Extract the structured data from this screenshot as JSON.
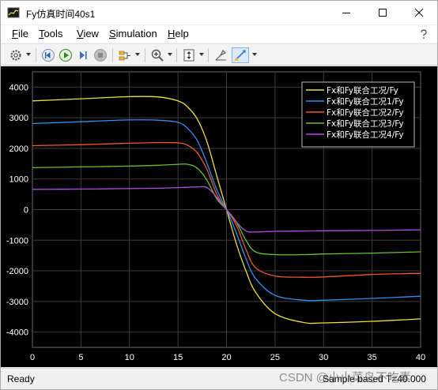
{
  "window": {
    "title": "Fy仿真时间40s1"
  },
  "menu": {
    "items": [
      {
        "label": "File",
        "u": "F",
        "rest": "ile"
      },
      {
        "label": "Tools",
        "u": "T",
        "rest": "ools"
      },
      {
        "label": "View",
        "u": "V",
        "rest": "iew"
      },
      {
        "label": "Simulation",
        "u": "S",
        "rest": "imulation"
      },
      {
        "label": "Help",
        "u": "H",
        "rest": "elp"
      }
    ]
  },
  "toolbar": {
    "icons": [
      "gear-icon",
      "step-back-icon",
      "run-icon",
      "step-forward-icon",
      "stop-icon",
      "highlight-icon",
      "zoom-in-icon",
      "autoscale-icon",
      "style-icon",
      "cursor-measure-icon"
    ]
  },
  "status": {
    "left": "Ready",
    "right": "Sample based  T=40.000"
  },
  "watermark": "CSDN @小小菜鸟不吃素",
  "chart_data": {
    "type": "line",
    "xlim": [
      0,
      40
    ],
    "ylim": [
      -4500,
      4500
    ],
    "x_ticks": [
      0,
      5,
      10,
      15,
      20,
      25,
      30,
      35,
      40
    ],
    "y_ticks": [
      -4000,
      -3000,
      -2000,
      -1000,
      0,
      1000,
      2000,
      3000,
      4000
    ],
    "grid": true,
    "legend_position": "top-right",
    "colors": {
      "background": "#000000",
      "grid": "#3c3c3c",
      "axis_text": "#ffffff"
    },
    "x": [
      0,
      5,
      10,
      13,
      15,
      16,
      17,
      18,
      19,
      20,
      21,
      22,
      23,
      25,
      28,
      30,
      35,
      40
    ],
    "series": [
      {
        "name": "Fx和Fy联合工况/Fy",
        "color": "#e8e23a",
        "values": [
          3550,
          3620,
          3690,
          3680,
          3550,
          3350,
          2950,
          2200,
          1100,
          0,
          -1100,
          -2000,
          -2700,
          -3400,
          -3690,
          -3700,
          -3650,
          -3570
        ]
      },
      {
        "name": "Fx和Fy联合工况1/Fy",
        "color": "#2f8ff0",
        "values": [
          2810,
          2870,
          2930,
          2920,
          2850,
          2650,
          2250,
          1500,
          650,
          0,
          -750,
          -1600,
          -2250,
          -2800,
          -2960,
          -2960,
          -2900,
          -2830
        ]
      },
      {
        "name": "Fx和Fy联合工况2/Fy",
        "color": "#ee5a2a",
        "values": [
          2090,
          2120,
          2170,
          2190,
          2180,
          2100,
          1850,
          1300,
          500,
          0,
          -500,
          -1300,
          -1900,
          -2170,
          -2210,
          -2200,
          -2120,
          -2080
        ]
      },
      {
        "name": "Fx和Fy联合工况3/Fy",
        "color": "#66c32a",
        "values": [
          1370,
          1395,
          1420,
          1450,
          1480,
          1480,
          1350,
          950,
          350,
          0,
          -400,
          -1000,
          -1380,
          -1470,
          -1470,
          -1450,
          -1420,
          -1380
        ]
      },
      {
        "name": "Fx和Fy联合工况4/Fy",
        "color": "#b14ee0",
        "values": [
          660,
          670,
          685,
          700,
          720,
          730,
          740,
          720,
          400,
          0,
          -400,
          -700,
          -730,
          -710,
          -700,
          -690,
          -680,
          -660
        ]
      }
    ]
  }
}
